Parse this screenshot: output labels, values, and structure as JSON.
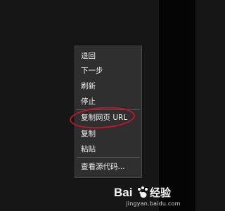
{
  "context_menu": {
    "items": [
      {
        "label": "退回"
      },
      {
        "label": "下一步"
      },
      {
        "label": "刷新"
      },
      {
        "label": "停止"
      },
      {
        "label": "复制网页 URL"
      },
      {
        "label": "复制"
      },
      {
        "label": "粘贴"
      },
      {
        "label": "查看源代码..."
      }
    ]
  },
  "annotation": {
    "color": "#c3142a"
  },
  "watermark": {
    "logo_text": "Baidu经验",
    "url": "jingyan.baidu.com"
  }
}
